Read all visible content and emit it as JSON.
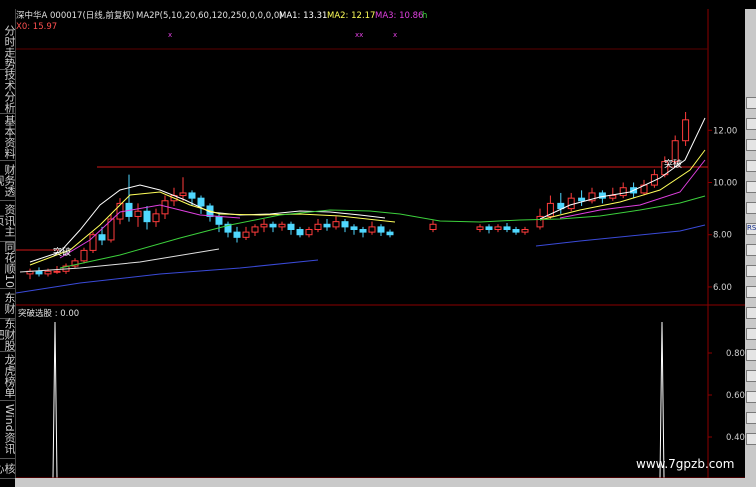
{
  "main_header": {
    "title": "深中华A 000017(日线,前复权)",
    "ma_spec": "MA2P(5,10,20,60,120,250,0,0,0,0)",
    "ma1": "MA1: 13.31",
    "ma2": "MA2: 12.17",
    "ma3": "MA3: 10.86",
    "more": "h",
    "x0": "X0: 15.97"
  },
  "left_tabs": [
    "分时走势",
    "技术分析",
    "基本资料",
    "财务透视",
    "资讯主页",
    "同花顺10",
    "东财",
    "东财股吧",
    "龙虎榜单",
    "Wind资讯",
    "核心"
  ],
  "price_axis": {
    "ticks": [
      "12.00",
      "10.00",
      "8.00",
      "6.00"
    ]
  },
  "indicator": {
    "title": "突破选股 : 0.00",
    "ticks": [
      "0.80",
      "0.60",
      "0.40"
    ],
    "top_value": "10"
  },
  "annotations": {
    "breakout_left": "突破",
    "breakout_right": "突破"
  },
  "watermark": "www.7gpzb.com",
  "right_panel": [
    "",
    "",
    "",
    "",
    "",
    "",
    "RS",
    "",
    "",
    "",
    "",
    "",
    "",
    "",
    "",
    "",
    ""
  ],
  "colors": {
    "up": "#ff3c3c",
    "down": "#50d8ff",
    "grid": "#8b0000",
    "ma_white": "#ffffff",
    "ma_yellow": "#ffff5a",
    "ma_magenta": "#e040e0",
    "ma_green": "#3cd03c",
    "ma_blue": "#3a4ad8",
    "ma_white2": "#e0e0e0"
  },
  "chart_data": {
    "type": "candlestick",
    "y_range": [
      5.5,
      12.7
    ],
    "candles": [
      {
        "o": 6.5,
        "c": 6.6,
        "h": 6.7,
        "l": 6.3
      },
      {
        "o": 6.6,
        "c": 6.5,
        "h": 6.75,
        "l": 6.4
      },
      {
        "o": 6.5,
        "c": 6.6,
        "h": 6.7,
        "l": 6.4
      },
      {
        "o": 6.6,
        "c": 6.6,
        "h": 6.8,
        "l": 6.5
      },
      {
        "o": 6.6,
        "c": 6.8,
        "h": 6.9,
        "l": 6.5
      },
      {
        "o": 6.8,
        "c": 7.0,
        "h": 7.1,
        "l": 6.7
      },
      {
        "o": 7.0,
        "c": 7.4,
        "h": 7.5,
        "l": 6.9
      },
      {
        "o": 7.4,
        "c": 8.0,
        "h": 8.1,
        "l": 7.3
      },
      {
        "o": 8.0,
        "c": 7.8,
        "h": 8.3,
        "l": 7.6
      },
      {
        "o": 7.8,
        "c": 8.6,
        "h": 8.8,
        "l": 7.7
      },
      {
        "o": 8.6,
        "c": 9.2,
        "h": 9.4,
        "l": 8.4
      },
      {
        "o": 9.2,
        "c": 8.7,
        "h": 10.3,
        "l": 8.5
      },
      {
        "o": 8.7,
        "c": 8.9,
        "h": 9.2,
        "l": 8.3
      },
      {
        "o": 8.9,
        "c": 8.5,
        "h": 9.1,
        "l": 8.2
      },
      {
        "o": 8.5,
        "c": 8.8,
        "h": 9.0,
        "l": 8.3
      },
      {
        "o": 8.8,
        "c": 9.3,
        "h": 9.5,
        "l": 8.6
      },
      {
        "o": 9.3,
        "c": 9.5,
        "h": 9.8,
        "l": 9.1
      },
      {
        "o": 9.5,
        "c": 9.6,
        "h": 10.2,
        "l": 9.3
      },
      {
        "o": 9.6,
        "c": 9.4,
        "h": 9.7,
        "l": 9.1
      },
      {
        "o": 9.4,
        "c": 9.1,
        "h": 9.5,
        "l": 8.8
      },
      {
        "o": 9.1,
        "c": 8.7,
        "h": 9.2,
        "l": 8.5
      },
      {
        "o": 8.7,
        "c": 8.4,
        "h": 8.8,
        "l": 8.1
      },
      {
        "o": 8.4,
        "c": 8.1,
        "h": 8.5,
        "l": 7.9
      },
      {
        "o": 8.1,
        "c": 7.9,
        "h": 8.3,
        "l": 7.7
      },
      {
        "o": 7.9,
        "c": 8.1,
        "h": 8.3,
        "l": 7.8
      },
      {
        "o": 8.1,
        "c": 8.3,
        "h": 8.4,
        "l": 7.95
      },
      {
        "o": 8.3,
        "c": 8.4,
        "h": 8.6,
        "l": 8.1
      },
      {
        "o": 8.4,
        "c": 8.3,
        "h": 8.5,
        "l": 8.1
      },
      {
        "o": 8.3,
        "c": 8.4,
        "h": 8.5,
        "l": 8.15
      },
      {
        "o": 8.4,
        "c": 8.2,
        "h": 8.5,
        "l": 8.0
      },
      {
        "o": 8.2,
        "c": 8.0,
        "h": 8.3,
        "l": 7.9
      },
      {
        "o": 8.0,
        "c": 8.2,
        "h": 8.3,
        "l": 7.9
      },
      {
        "o": 8.2,
        "c": 8.4,
        "h": 8.6,
        "l": 8.1
      },
      {
        "o": 8.4,
        "c": 8.3,
        "h": 8.6,
        "l": 8.15
      },
      {
        "o": 8.3,
        "c": 8.5,
        "h": 8.7,
        "l": 8.2
      },
      {
        "o": 8.5,
        "c": 8.3,
        "h": 8.6,
        "l": 8.1
      },
      {
        "o": 8.3,
        "c": 8.2,
        "h": 8.4,
        "l": 8.0
      },
      {
        "o": 8.2,
        "c": 8.1,
        "h": 8.3,
        "l": 7.9
      },
      {
        "o": 8.1,
        "c": 8.3,
        "h": 8.5,
        "l": 8.0
      },
      {
        "o": 8.3,
        "c": 8.1,
        "h": 8.4,
        "l": 7.95
      },
      {
        "o": 8.1,
        "c": 8.0,
        "h": 8.2,
        "l": 7.9
      },
      {
        "o": 8.2,
        "c": 8.4,
        "h": 8.55,
        "l": 8.1
      },
      {
        "o": 8.2,
        "c": 8.3,
        "h": 8.4,
        "l": 8.1
      },
      {
        "o": 8.3,
        "c": 8.2,
        "h": 8.4,
        "l": 8.05
      },
      {
        "o": 8.2,
        "c": 8.3,
        "h": 8.4,
        "l": 8.1
      },
      {
        "o": 8.3,
        "c": 8.2,
        "h": 8.45,
        "l": 8.1
      },
      {
        "o": 8.2,
        "c": 8.1,
        "h": 8.3,
        "l": 8.0
      },
      {
        "o": 8.1,
        "c": 8.2,
        "h": 8.3,
        "l": 8.0
      },
      {
        "o": 8.3,
        "c": 8.7,
        "h": 9.0,
        "l": 8.2
      },
      {
        "o": 8.7,
        "c": 9.2,
        "h": 9.5,
        "l": 8.6
      },
      {
        "o": 9.2,
        "c": 9.0,
        "h": 9.6,
        "l": 8.8
      },
      {
        "o": 9.0,
        "c": 9.4,
        "h": 9.6,
        "l": 8.9
      },
      {
        "o": 9.4,
        "c": 9.3,
        "h": 9.7,
        "l": 9.1
      },
      {
        "o": 9.3,
        "c": 9.6,
        "h": 9.8,
        "l": 9.2
      },
      {
        "o": 9.6,
        "c": 9.4,
        "h": 9.7,
        "l": 9.2
      },
      {
        "o": 9.4,
        "c": 9.5,
        "h": 9.8,
        "l": 9.3
      },
      {
        "o": 9.5,
        "c": 9.8,
        "h": 10.0,
        "l": 9.4
      },
      {
        "o": 9.8,
        "c": 9.6,
        "h": 10.0,
        "l": 9.4
      },
      {
        "o": 9.6,
        "c": 9.9,
        "h": 10.1,
        "l": 9.5
      },
      {
        "o": 9.9,
        "c": 10.3,
        "h": 10.5,
        "l": 9.8
      },
      {
        "o": 10.3,
        "c": 10.8,
        "h": 11.0,
        "l": 10.2
      },
      {
        "o": 10.8,
        "c": 11.6,
        "h": 11.8,
        "l": 10.7
      },
      {
        "o": 11.6,
        "c": 12.4,
        "h": 12.7,
        "l": 11.4
      }
    ],
    "breakout_signal_positions": [
      1,
      63
    ]
  }
}
